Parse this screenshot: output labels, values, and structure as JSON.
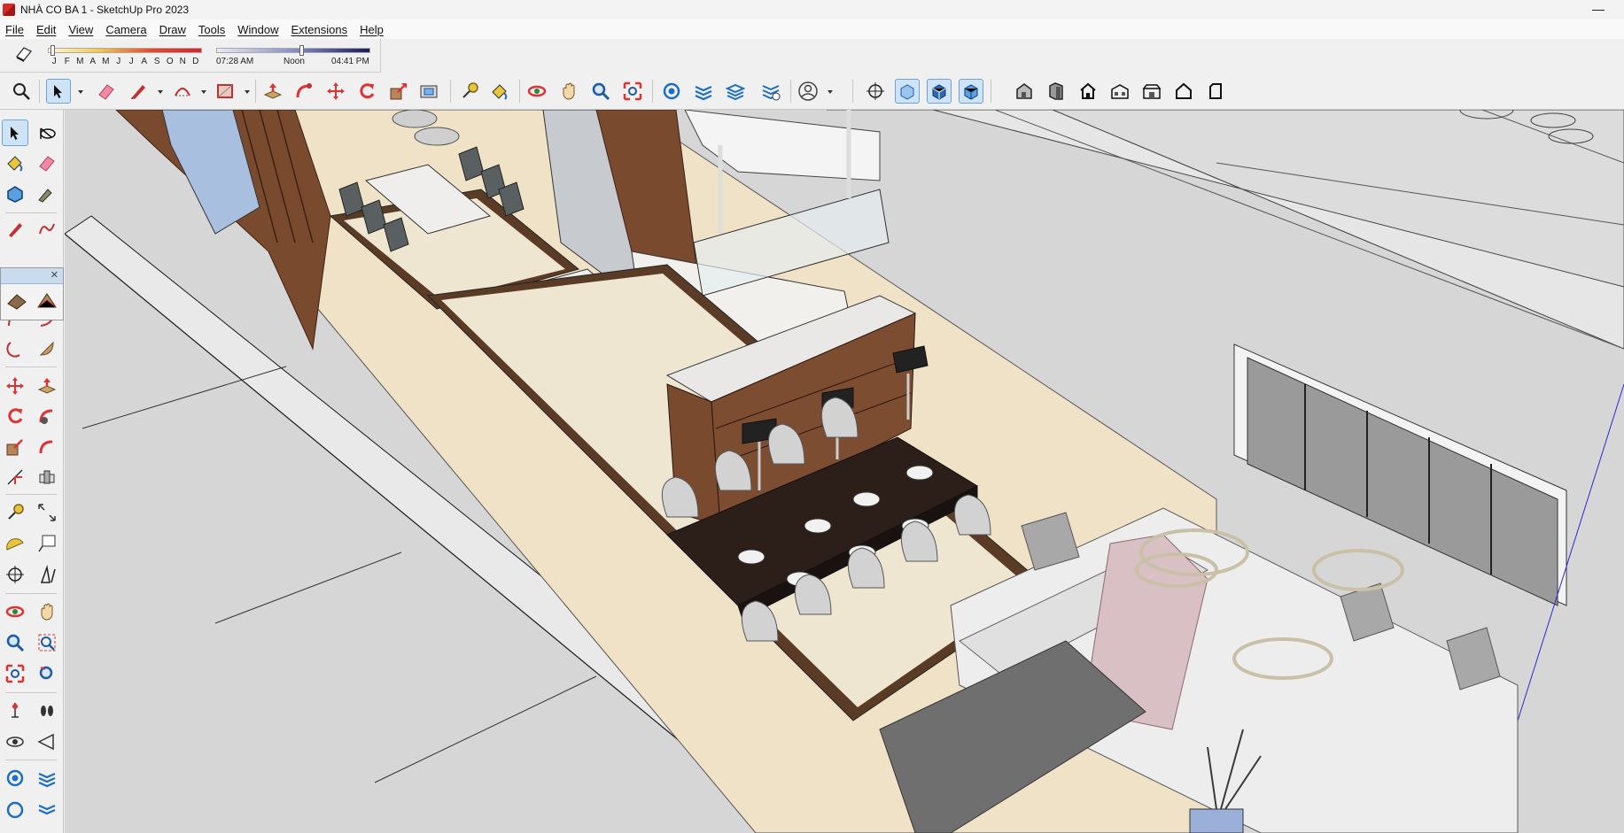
{
  "window": {
    "title": "NHÀ CO BA 1 - SketchUp Pro 2023",
    "minimize_glyph": "—"
  },
  "menu": [
    "File",
    "Edit",
    "View",
    "Camera",
    "Draw",
    "Tools",
    "Window",
    "Extensions",
    "Help"
  ],
  "shadows": {
    "months": [
      "J",
      "F",
      "M",
      "A",
      "M",
      "J",
      "J",
      "A",
      "S",
      "O",
      "N",
      "D"
    ],
    "sunrise": "07:28 AM",
    "noon": "Noon",
    "sunset": "04:41 PM",
    "month_position": 0.02,
    "time_position": 0.55
  },
  "toolbar_icons": [
    "search-icon",
    "select-arrow-icon",
    "eraser-icon",
    "pencil-icon",
    "arc-icon",
    "rectangle-icon",
    "push-pull-icon",
    "follow-me-icon",
    "move-icon",
    "rotate-icon",
    "scale-icon",
    "offset-icon",
    "tape-measure-icon",
    "paint-bucket-icon",
    "orbit-icon",
    "pan-icon",
    "zoom-icon",
    "zoom-extents-icon",
    "component-icon",
    "section-plane-icon",
    "layers-icon",
    "extension-icon",
    "user-account-icon",
    "axes-icon",
    "xray-icon",
    "back-edges-icon",
    "hidden-line-icon",
    "iso-view-icon",
    "front-view-icon",
    "top-view-icon",
    "right-view-icon",
    "back-view-icon",
    "left-view-icon",
    "bottom-view-icon"
  ],
  "left_tools": [
    "select-icon",
    "orbit-icon",
    "paint-bucket-icon",
    "eraser-icon",
    "component-icon",
    "tag-icon",
    "pencil-icon",
    "freehand-icon",
    "rectangle-icon",
    "rotated-rect-icon",
    "sandbox-icon",
    "terrain-icon",
    "arc-icon",
    "pie-icon",
    "two-point-arc-icon",
    "polygon-icon",
    "move-icon",
    "push-pull-icon",
    "rotate-icon",
    "follow-me-icon",
    "scale-icon",
    "offset-icon",
    "tape-measure-icon",
    "dimension-icon",
    "protractor-icon",
    "text-icon",
    "axes-icon",
    "3d-text-icon",
    "orbit-view-icon",
    "pan-view-icon",
    "zoom-icon",
    "zoom-window-icon",
    "zoom-extents-icon",
    "previous-view-icon",
    "position-camera-icon",
    "walk-icon",
    "look-around-icon",
    "section-icon",
    "warehouse-icon",
    "layers-icon"
  ],
  "colors": {
    "accent": "#3d7fc7",
    "viewport_bg": "#d6d6d6",
    "wood": "#7a4a2f",
    "marble": "#e9e6e2",
    "floor": "#efe2c6"
  }
}
